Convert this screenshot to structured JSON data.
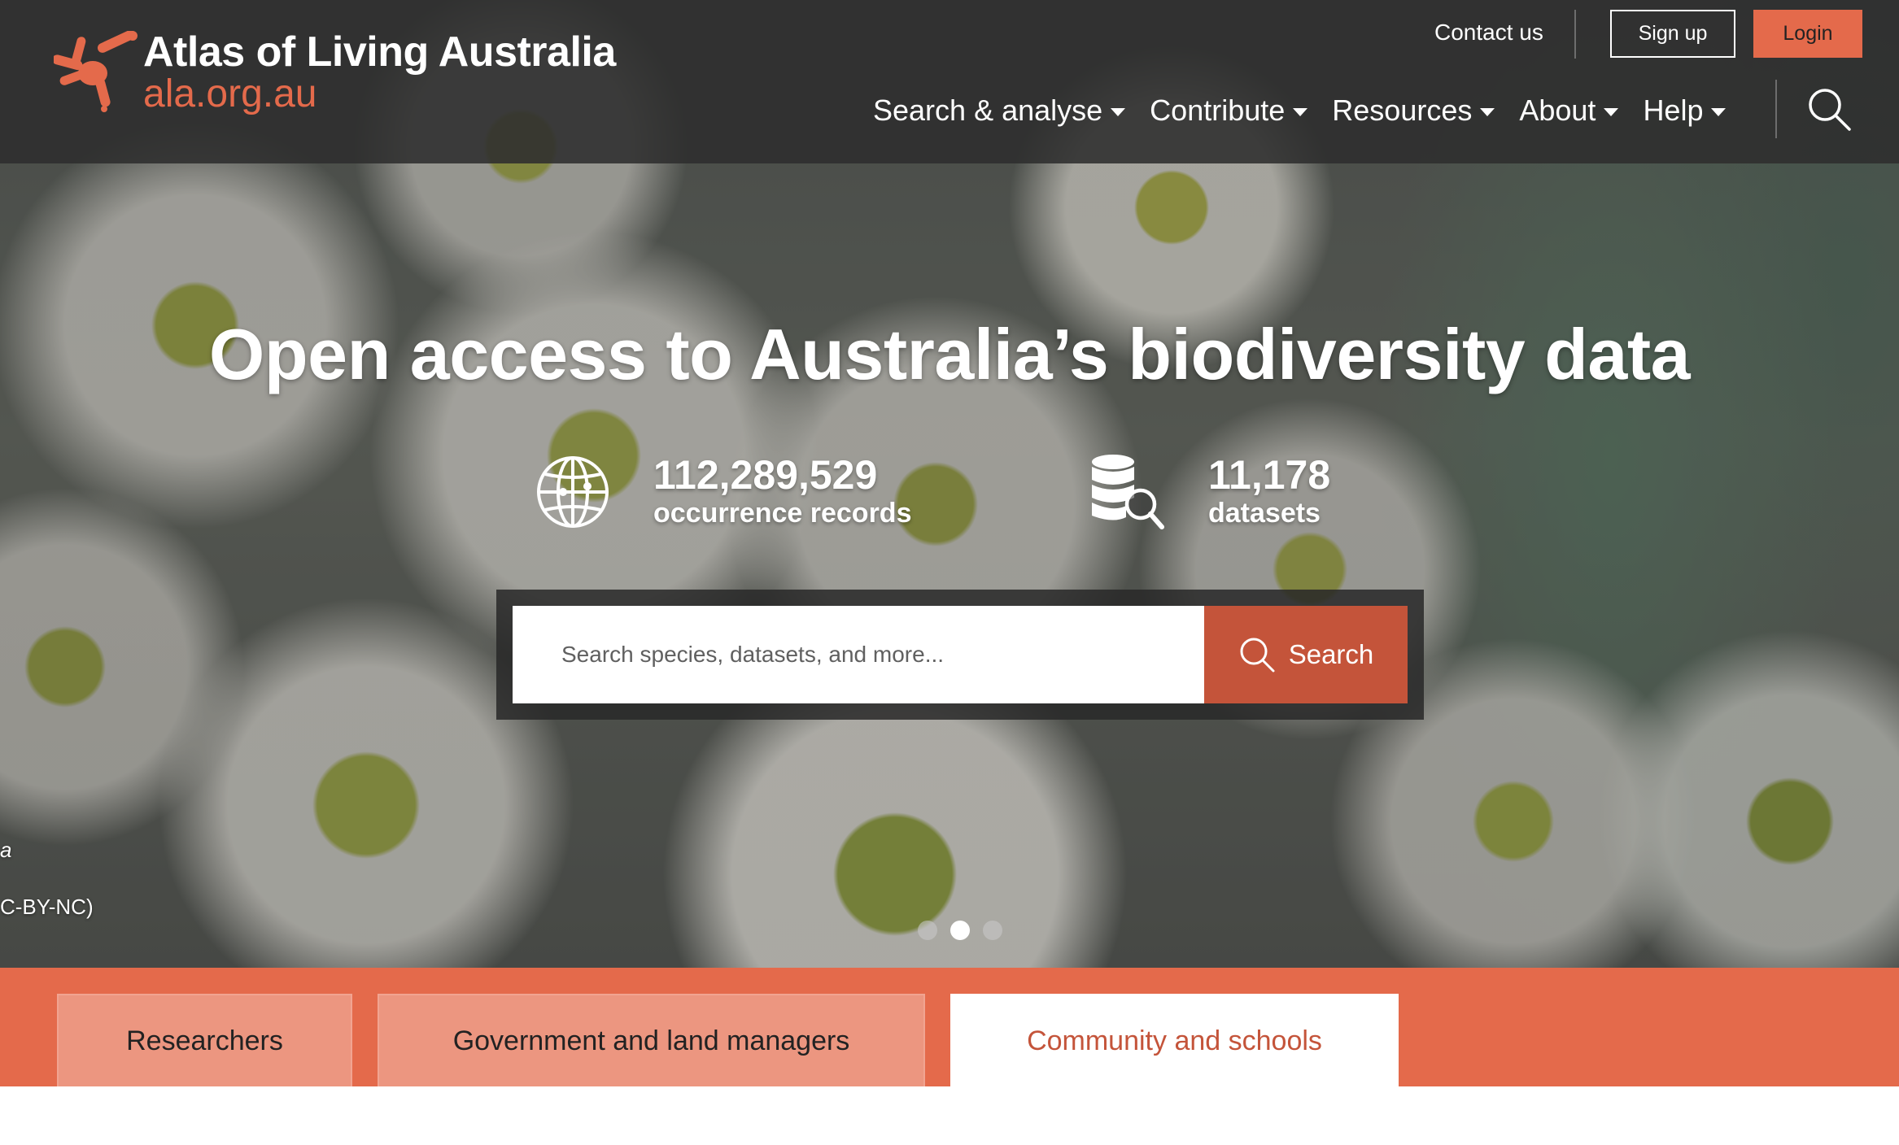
{
  "header": {
    "brand_title": "Atlas of Living Australia",
    "brand_url": "ala.org.au",
    "contact_label": "Contact us",
    "signup_label": "Sign up",
    "login_label": "Login",
    "nav": [
      {
        "label": "Search & analyse"
      },
      {
        "label": "Contribute"
      },
      {
        "label": "Resources"
      },
      {
        "label": "About"
      },
      {
        "label": "Help"
      }
    ]
  },
  "hero": {
    "headline": "Open access to Australia’s biodiversity data",
    "stats": [
      {
        "number": "112,289,529",
        "label": "occurrence records",
        "icon": "globe-icon"
      },
      {
        "number": "11,178",
        "label": "datasets",
        "icon": "database-search-icon"
      }
    ],
    "search": {
      "placeholder": "Search species, datasets, and more...",
      "button_label": "Search"
    },
    "credit_line1": "a",
    "credit_line2": "C-BY-NC)",
    "carousel": {
      "count": 3,
      "active_index": 1
    }
  },
  "tabs": [
    {
      "label": "Researchers",
      "active": false
    },
    {
      "label": "Government and land managers",
      "active": false
    },
    {
      "label": "Community and schools",
      "active": true
    }
  ],
  "colors": {
    "brand_orange": "#e46a4b",
    "search_button": "#c4543a",
    "header_bg": "#2d2d2d"
  }
}
